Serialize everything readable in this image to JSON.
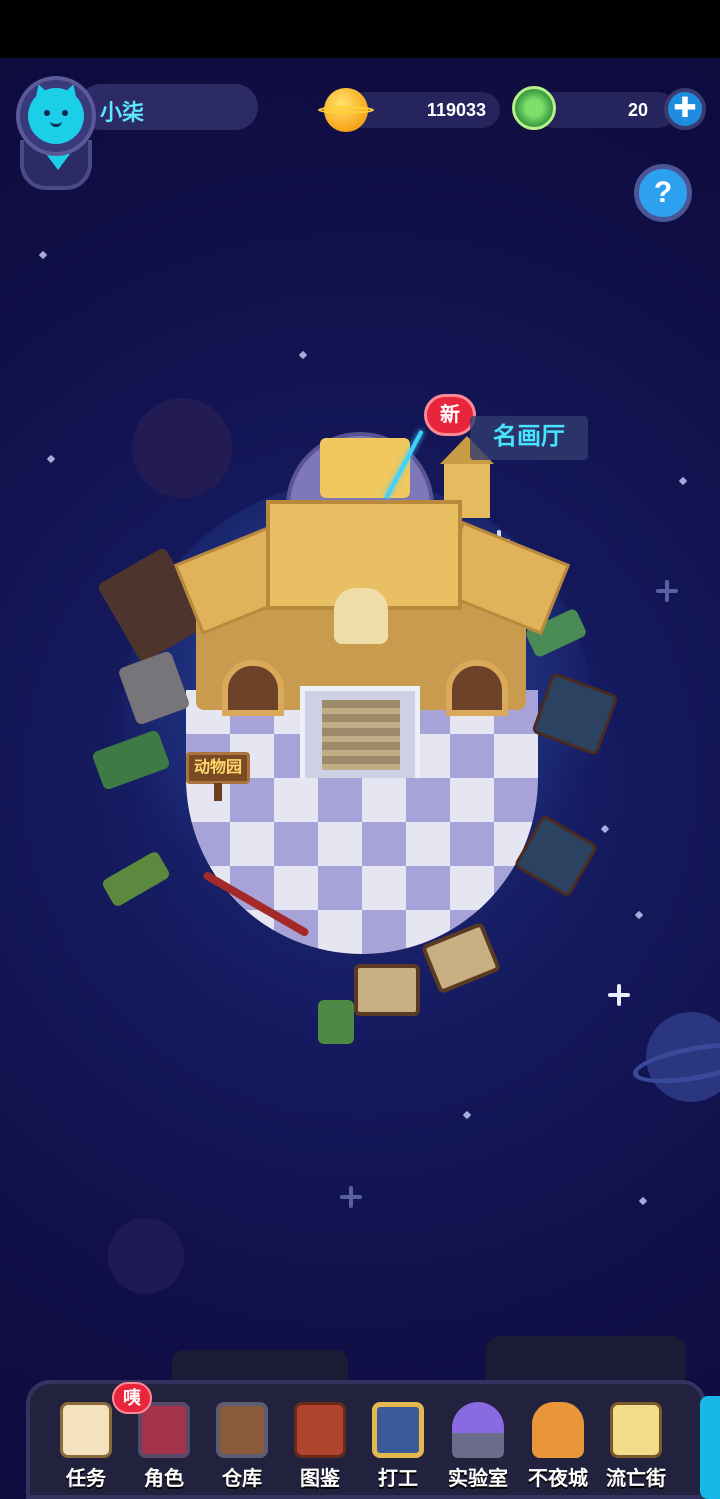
{
  "header": {
    "username": "小柒",
    "coins": "119033",
    "gems": "20",
    "add_label": "✚",
    "help_label": "?"
  },
  "world": {
    "new_badge": "新",
    "gallery_label": "名画厅",
    "zoo_sign": "动物园"
  },
  "dock": {
    "badge": "咦",
    "items": [
      {
        "label": "任务",
        "icon": "scroll-icon"
      },
      {
        "label": "角色",
        "icon": "character-icon"
      },
      {
        "label": "仓库",
        "icon": "chest-icon"
      },
      {
        "label": "图鉴",
        "icon": "book-icon"
      },
      {
        "label": "打工",
        "icon": "tv-icon"
      },
      {
        "label": "实验室",
        "icon": "lab-icon"
      },
      {
        "label": "不夜城",
        "icon": "fox-city-icon"
      },
      {
        "label": "流亡街",
        "icon": "pirate-cat-icon"
      }
    ]
  },
  "colors": {
    "accent": "#5fe6ff",
    "badge_red": "#e8253a",
    "background": "#110f48"
  }
}
